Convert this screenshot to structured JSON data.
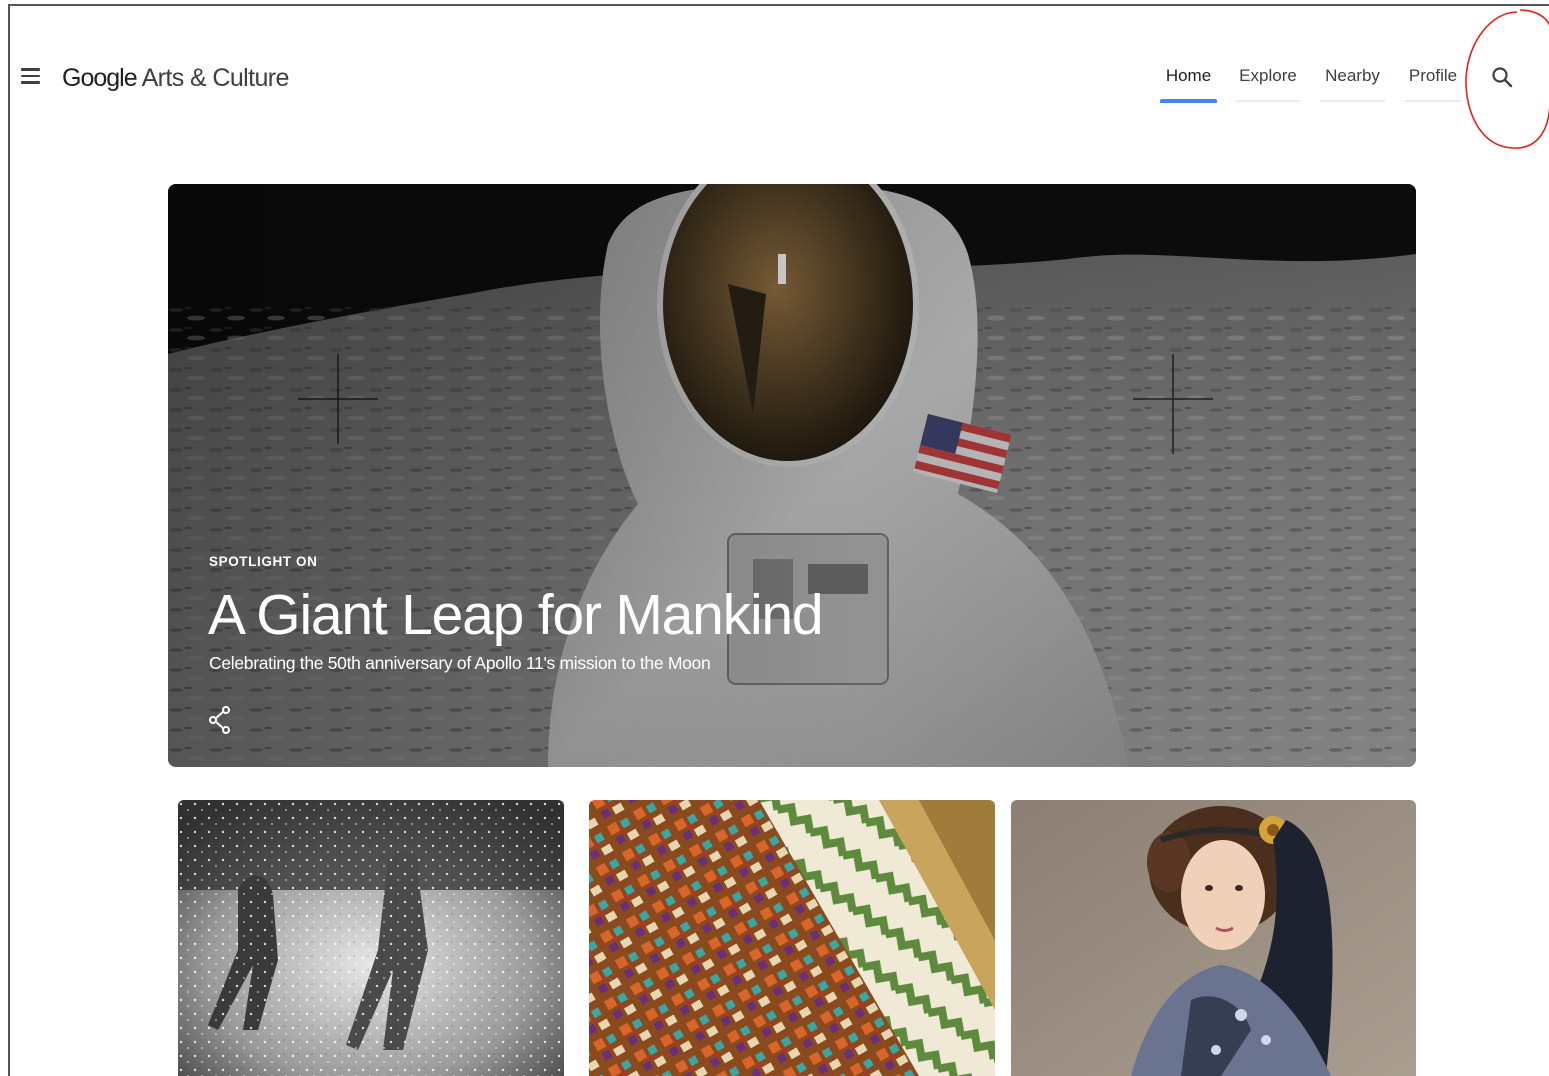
{
  "header": {
    "logo_google": "Google",
    "logo_rest": " Arts & Culture",
    "menu_icon": "hamburger-menu-icon",
    "search_icon": "search-icon",
    "nav": [
      {
        "label": "Home",
        "active": true
      },
      {
        "label": "Explore",
        "active": false
      },
      {
        "label": "Nearby",
        "active": false
      },
      {
        "label": "Profile",
        "active": false
      }
    ]
  },
  "hero": {
    "kicker": "SPOTLIGHT ON",
    "title": "A Giant Leap for Mankind",
    "subtitle": "Celebrating the 50th anniversary of Apollo 11's mission to the Moon",
    "share_icon": "share-icon"
  },
  "cards": [
    {
      "image": "children-running-in-water-spray-photo"
    },
    {
      "image": "embroidered-textile-photo"
    },
    {
      "image": "ada-lovelace-portrait"
    }
  ],
  "colors": {
    "accent": "#4285f4",
    "text": "#202124",
    "annotation": "#e0241b"
  }
}
